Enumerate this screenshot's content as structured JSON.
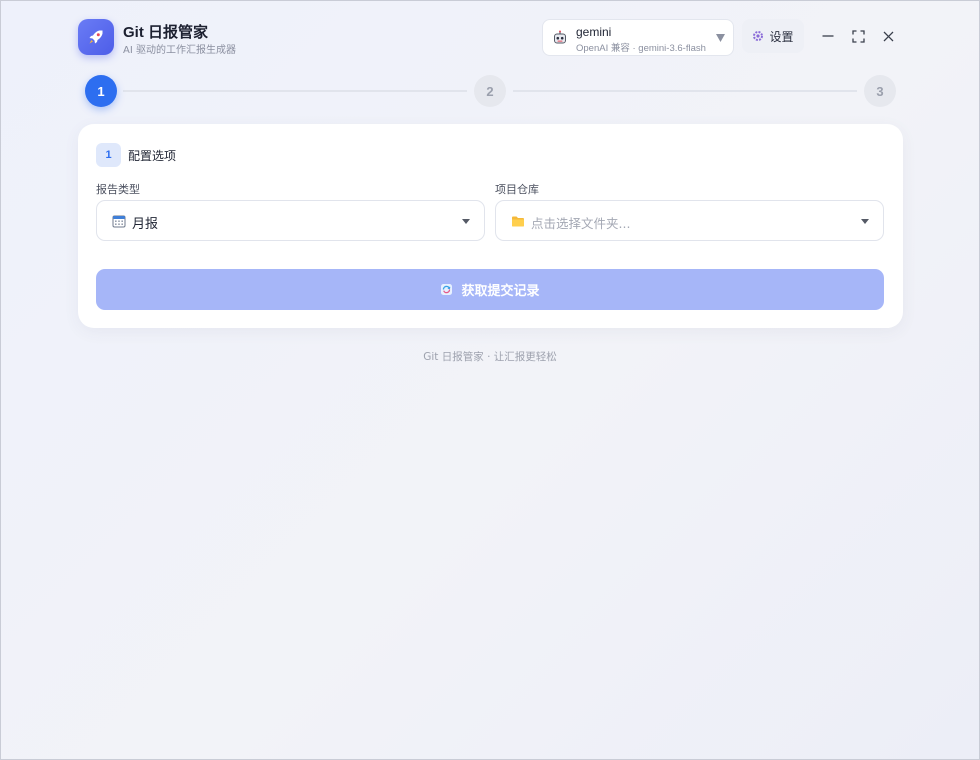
{
  "app": {
    "title": "Git 日报管家",
    "subtitle": "AI 驱动的工作汇报生成器"
  },
  "model": {
    "name": "gemini",
    "detail": "OpenAI 兼容 · gemini-3.6-flash"
  },
  "toolbar": {
    "settings_label": "设置"
  },
  "stepper": {
    "steps": [
      "1",
      "2",
      "3"
    ],
    "active": 1
  },
  "config": {
    "badge": "1",
    "title": "配置选项",
    "report_type": {
      "label": "报告类型",
      "value": "月报"
    },
    "repository": {
      "label": "项目仓库",
      "placeholder": "点击选择文件夹..."
    },
    "fetch_button_label": "获取提交记录"
  },
  "footer": {
    "text": "Git 日报管家 · 让汇报更轻松"
  },
  "colors": {
    "accent": "#2d6ef0",
    "button_disabled": "#a6b6f8",
    "logo": "#5566ec"
  }
}
